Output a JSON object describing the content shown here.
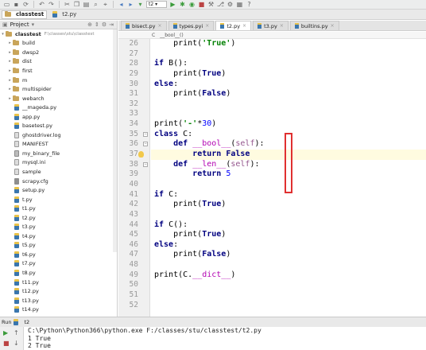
{
  "toolbar": {
    "run_config": "t2",
    "icons": [
      "open-icon",
      "save-icon",
      "sync-icon",
      "back-icon",
      "forward-icon",
      "cut-icon",
      "copy-icon",
      "paste-icon",
      "find-icon",
      "replace-icon",
      "nav-back-icon",
      "nav-forward-icon",
      "run-config-select",
      "run-icon",
      "debug-icon",
      "coverage-icon",
      "stop-icon",
      "build-icon",
      "vcs-icon",
      "settings-icon",
      "structure-icon",
      "help-icon"
    ]
  },
  "breadcrumb": {
    "project": "classtest",
    "file": "t2.py"
  },
  "project_panel": {
    "title": "Project",
    "root_name": "classtest",
    "root_path": "F:\\classes\\stu\\classtest",
    "items": [
      {
        "label": "build",
        "kind": "folder"
      },
      {
        "label": "dwsp2",
        "kind": "folder"
      },
      {
        "label": "dist",
        "kind": "folder"
      },
      {
        "label": "first",
        "kind": "folder"
      },
      {
        "label": "m",
        "kind": "folder"
      },
      {
        "label": "multispider",
        "kind": "folder"
      },
      {
        "label": "webarch",
        "kind": "folder"
      },
      {
        "label": "__mageda.py",
        "kind": "py"
      },
      {
        "label": "app.py",
        "kind": "py"
      },
      {
        "label": "basetest.py",
        "kind": "py"
      },
      {
        "label": "ghostdriver.log",
        "kind": "txt"
      },
      {
        "label": "MANIFEST",
        "kind": "txt"
      },
      {
        "label": "my_binary_file",
        "kind": "bin"
      },
      {
        "label": "mysql.ini",
        "kind": "txt"
      },
      {
        "label": "sample",
        "kind": "txt"
      },
      {
        "label": "scrapy.cfg",
        "kind": "cfg"
      },
      {
        "label": "setup.py",
        "kind": "py"
      },
      {
        "label": "t.py",
        "kind": "py"
      },
      {
        "label": "t1.py",
        "kind": "py"
      },
      {
        "label": "t2.py",
        "kind": "py"
      },
      {
        "label": "t3.py",
        "kind": "py"
      },
      {
        "label": "t4.py",
        "kind": "py"
      },
      {
        "label": "t5.py",
        "kind": "py"
      },
      {
        "label": "t6.py",
        "kind": "py"
      },
      {
        "label": "t7.py",
        "kind": "py"
      },
      {
        "label": "t8.py",
        "kind": "py"
      },
      {
        "label": "t11.py",
        "kind": "py"
      },
      {
        "label": "t12.py",
        "kind": "py"
      },
      {
        "label": "t13.py",
        "kind": "py"
      },
      {
        "label": "t14.py",
        "kind": "py"
      }
    ]
  },
  "editor": {
    "tabs": [
      {
        "label": "bisect.py",
        "active": false
      },
      {
        "label": "types.pyi",
        "active": false
      },
      {
        "label": "t2.py",
        "active": true
      },
      {
        "label": "t3.py",
        "active": false
      },
      {
        "label": "builtins.py",
        "active": false
      }
    ],
    "crumbs": [
      "C",
      "__bool__()"
    ],
    "first_line": 26,
    "current_line": 37,
    "lines": [
      [
        {
          "t": "    print("
        },
        {
          "t": "'True'",
          "c": "str"
        },
        {
          "t": ")"
        }
      ],
      [],
      [
        {
          "t": "if",
          "c": "kw"
        },
        {
          "t": " B():"
        }
      ],
      [
        {
          "t": "    print("
        },
        {
          "t": "True",
          "c": "kw"
        },
        {
          "t": ")"
        }
      ],
      [
        {
          "t": "else",
          "c": "kw"
        },
        {
          "t": ":"
        }
      ],
      [
        {
          "t": "    print("
        },
        {
          "t": "False",
          "c": "kw"
        },
        {
          "t": ")"
        }
      ],
      [],
      [],
      [
        {
          "t": "print("
        },
        {
          "t": "'-'",
          "c": "str"
        },
        {
          "t": "*"
        },
        {
          "t": "30",
          "c": "num"
        },
        {
          "t": ")"
        }
      ],
      [
        {
          "t": "class",
          "c": "kw"
        },
        {
          "t": " C:"
        }
      ],
      [
        {
          "t": "    "
        },
        {
          "t": "def",
          "c": "kw"
        },
        {
          "t": " "
        },
        {
          "t": "__bool__",
          "c": "dunder"
        },
        {
          "t": "("
        },
        {
          "t": "self",
          "c": "self"
        },
        {
          "t": "):"
        }
      ],
      [
        {
          "t": "        "
        },
        {
          "t": "return",
          "c": "kw"
        },
        {
          "t": " "
        },
        {
          "t": "False",
          "c": "kw"
        }
      ],
      [
        {
          "t": "    "
        },
        {
          "t": "def",
          "c": "kw"
        },
        {
          "t": " "
        },
        {
          "t": "__len__",
          "c": "dunder"
        },
        {
          "t": "("
        },
        {
          "t": "self",
          "c": "self"
        },
        {
          "t": "):"
        }
      ],
      [
        {
          "t": "        "
        },
        {
          "t": "return",
          "c": "kw"
        },
        {
          "t": " "
        },
        {
          "t": "5",
          "c": "num"
        }
      ],
      [],
      [
        {
          "t": "if",
          "c": "kw"
        },
        {
          "t": " C:"
        }
      ],
      [
        {
          "t": "    print("
        },
        {
          "t": "True",
          "c": "kw"
        },
        {
          "t": ")"
        }
      ],
      [],
      [
        {
          "t": "if",
          "c": "kw"
        },
        {
          "t": " C():"
        }
      ],
      [
        {
          "t": "    print("
        },
        {
          "t": "True",
          "c": "kw"
        },
        {
          "t": ")"
        }
      ],
      [
        {
          "t": "else",
          "c": "kw"
        },
        {
          "t": ":"
        }
      ],
      [
        {
          "t": "    print("
        },
        {
          "t": "False",
          "c": "kw"
        },
        {
          "t": ")"
        }
      ],
      [],
      [
        {
          "t": "print(C."
        },
        {
          "t": "__dict__",
          "c": "dunder"
        },
        {
          "t": ")"
        }
      ],
      [],
      [],
      []
    ],
    "fold_lines": [
      35,
      36,
      38
    ],
    "colors": {
      "keyword": "#000080",
      "string": "#008000",
      "number": "#0000ff",
      "self": "#94558d",
      "dunder": "#b200b2",
      "highlight_box": "#e03030"
    }
  },
  "run_panel": {
    "title": "Run",
    "config": "t2",
    "output": [
      "C:\\Python\\Python366\\python.exe F:/classes/stu/classtest/t2.py",
      "1 True",
      "2 True"
    ]
  }
}
